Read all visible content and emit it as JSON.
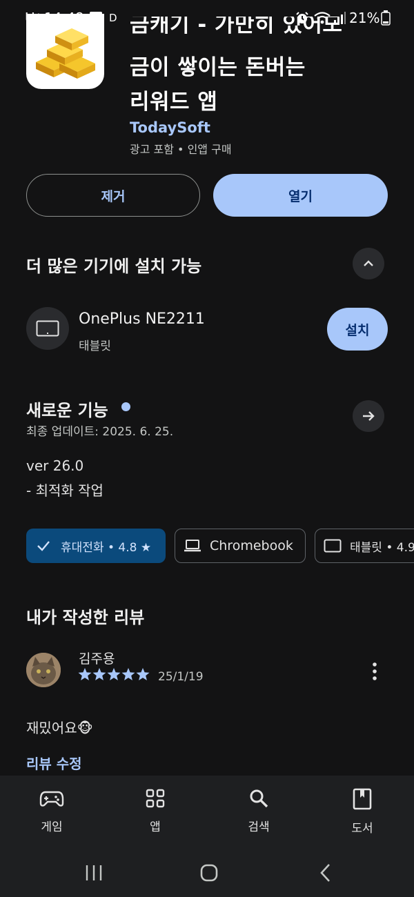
{
  "status_bar": {
    "carrier": "U⁺",
    "time": "14:48",
    "extra": "D",
    "battery": "21%"
  },
  "app": {
    "title_line1": "금캐기 - 가만히 있어도",
    "title_line2": "금이 쌓이는 돈버는",
    "title_line3": "리워드 앱",
    "developer": "TodaySoft",
    "meta": "광고 포함 • 인앱 구매"
  },
  "actions": {
    "uninstall_label": "제거",
    "open_label": "열기"
  },
  "devices_section": {
    "title": "더 많은 기기에 설치 가능",
    "device_name": "OnePlus NE2211",
    "device_type": "태블릿",
    "install_label": "설치"
  },
  "whats_new": {
    "title": "새로운 기능",
    "updated": "최종 업데이트: 2025. 6. 25.",
    "version": "ver 26.0",
    "notes": "- 최적화 작업"
  },
  "chips": [
    {
      "label": "휴대전화 • 4.8 ★"
    },
    {
      "label": "Chromebook"
    },
    {
      "label": "태블릿 • 4.9"
    }
  ],
  "my_review": {
    "title": "내가 작성한 리뷰",
    "author": "김주용",
    "stars": 5,
    "date": "25/1/19",
    "text": "재밌어요🐵",
    "edit_label": "리뷰 수정"
  },
  "bottom_nav": {
    "items": [
      {
        "label": "게임",
        "icon": "gamepad-icon"
      },
      {
        "label": "앱",
        "icon": "apps-grid-icon"
      },
      {
        "label": "검색",
        "icon": "search-icon"
      },
      {
        "label": "도서",
        "icon": "book-icon"
      }
    ]
  },
  "colors": {
    "background": "#131314",
    "accent": "#a8c7fa",
    "link": "#a8c7fa",
    "selected_chip": "#0b4a7c"
  }
}
